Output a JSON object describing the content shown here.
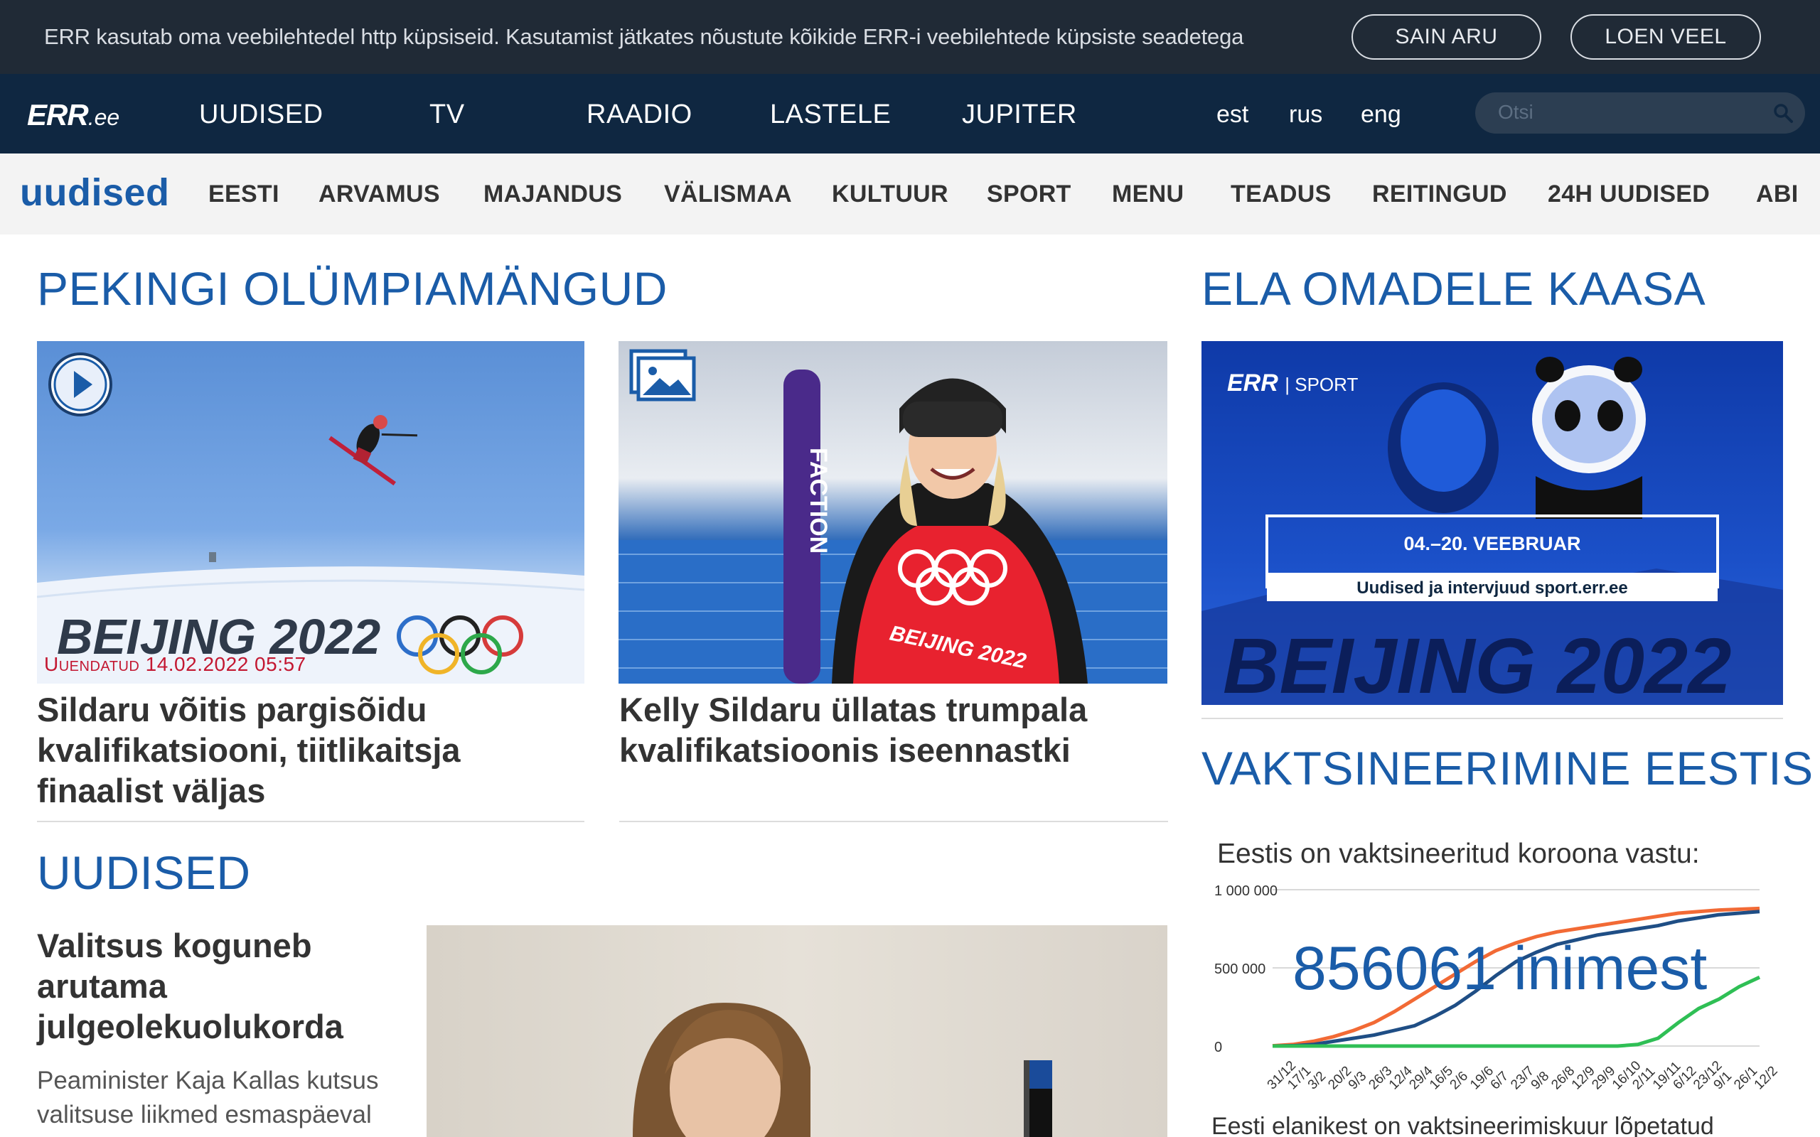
{
  "cookie": {
    "text": "ERR kasutab oma veebilehtedel http küpsiseid. Kasutamist jätkates nõustute kõikide ERR-i veebilehtede küpsiste seadetega",
    "accept_label": "SAIN ARU",
    "more_label": "LOEN VEEL"
  },
  "header": {
    "logo_main": "ERR",
    "logo_suffix": ".ee",
    "nav": [
      "UUDISED",
      "TV",
      "RAADIO",
      "LASTELE",
      "JUPITER"
    ],
    "langs": [
      "est",
      "rus",
      "eng"
    ],
    "search_placeholder": "Otsi"
  },
  "subnav": {
    "brand": "uudised",
    "items": [
      "EESTI",
      "ARVAMUS",
      "MAJANDUS",
      "VÄLISMAA",
      "KULTUUR",
      "SPORT",
      "MENU",
      "TEADUS",
      "REITINGUD",
      "24H UUDISED",
      "ABI"
    ]
  },
  "olympics": {
    "title": "PEKINGI OLÜMPIAMÄNGUD",
    "articles": [
      {
        "updated": "Uuendatud 14.02.2022 05:57",
        "headline": "Sildaru võitis pargisõidu kvalifikatsiooni, tiitlikaitsja finaalist väljas",
        "badge": "play-icon",
        "image_text": "BEIJING 2022"
      },
      {
        "headline": "Kelly Sildaru üllatas trumpala kvalifikatsioonis iseennastki",
        "badge": "gallery-icon",
        "image_text": "FACTION",
        "bib_text": "BEIJING 2022"
      }
    ]
  },
  "sidebar": {
    "title": "ELA OMADELE KAASA",
    "banner": {
      "brand": "ERR",
      "brand_sub": "SPORT",
      "dates": "04.–20. VEEBRUAR",
      "sub": "Uudised ja intervjuud sport.err.ee",
      "big": "BEIJING 2022"
    }
  },
  "vaccination": {
    "title": "VAKTSINEERIMINE EESTIS",
    "heading": "Eestis on vaktsineeritud koroona vastu:",
    "count_text": "856061 inimest",
    "footer": "Eesti elanikest on vaktsineerimiskuur lõpetatud"
  },
  "news": {
    "title": "UUDISED",
    "lead_headline": "Valitsus koguneb arutama julgeolekuolukorda",
    "lead_text": "Peaminister Kaja Kallas kutsus valitsuse liikmed esmaspäeval"
  },
  "chart_data": {
    "type": "line",
    "x": [
      "31/12",
      "17/1",
      "3/2",
      "20/2",
      "9/3",
      "26/3",
      "12/4",
      "29/4",
      "16/5",
      "2/6",
      "19/6",
      "6/7",
      "23/7",
      "9/8",
      "26/8",
      "12/9",
      "29/9",
      "16/10",
      "2/11",
      "19/11",
      "6/12",
      "23/12",
      "9/1",
      "26/1",
      "12/2"
    ],
    "ylim": [
      0,
      1000000
    ],
    "yticks": [
      "1 000 000",
      "500 000",
      "0"
    ],
    "series": [
      {
        "color": "#f26a35",
        "values": [
          2000,
          10000,
          30000,
          60000,
          100000,
          150000,
          220000,
          300000,
          380000,
          460000,
          540000,
          610000,
          660000,
          700000,
          730000,
          750000,
          770000,
          790000,
          810000,
          830000,
          850000,
          860000,
          870000,
          875000,
          880000
        ]
      },
      {
        "color": "#1f4e85",
        "values": [
          0,
          2000,
          10000,
          30000,
          50000,
          70000,
          100000,
          130000,
          190000,
          260000,
          350000,
          450000,
          540000,
          600000,
          650000,
          680000,
          710000,
          730000,
          750000,
          770000,
          800000,
          820000,
          840000,
          850000,
          860000
        ]
      },
      {
        "color": "#2fbf55",
        "values": [
          0,
          0,
          0,
          0,
          0,
          0,
          0,
          0,
          0,
          0,
          0,
          0,
          0,
          0,
          0,
          0,
          0,
          0,
          10000,
          50000,
          150000,
          240000,
          300000,
          380000,
          440000
        ]
      }
    ]
  }
}
